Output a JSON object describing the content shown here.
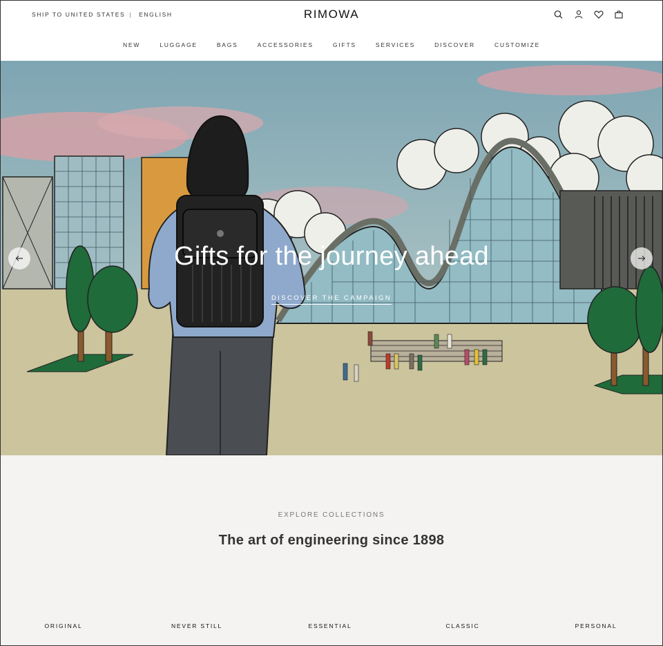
{
  "header": {
    "ship_to": "SHIP TO UNITED STATES",
    "separator": "|",
    "language": "ENGLISH",
    "logo": "RIMOWA",
    "utility_icons": [
      "search-icon",
      "account-icon",
      "heart-icon",
      "bag-icon"
    ]
  },
  "nav": {
    "items": [
      {
        "label": "NEW"
      },
      {
        "label": "LUGGAGE"
      },
      {
        "label": "BAGS"
      },
      {
        "label": "ACCESSORIES"
      },
      {
        "label": "GIFTS"
      },
      {
        "label": "SERVICES"
      },
      {
        "label": "DISCOVER"
      },
      {
        "label": "CUSTOMIZE"
      }
    ]
  },
  "hero": {
    "title": "Gifts for the journey ahead",
    "cta": "DISCOVER THE CAMPAIGN",
    "prev_icon": "arrow-left-icon",
    "next_icon": "arrow-right-icon"
  },
  "collections": {
    "eyebrow": "EXPLORE COLLECTIONS",
    "heading": "The art of engineering since 1898",
    "tabs": [
      {
        "label": "ORIGINAL"
      },
      {
        "label": "NEVER STILL"
      },
      {
        "label": "ESSENTIAL"
      },
      {
        "label": "CLASSIC"
      },
      {
        "label": "PERSONAL"
      }
    ]
  },
  "colors": {
    "sky_blue": "#8fb4bf",
    "cloud_pink": "#d9a8a9",
    "ground": "#c9c29a",
    "glass": "#9cc3ca",
    "tree_green": "#1f6b3a",
    "collections_bg": "#f4f3f1"
  }
}
